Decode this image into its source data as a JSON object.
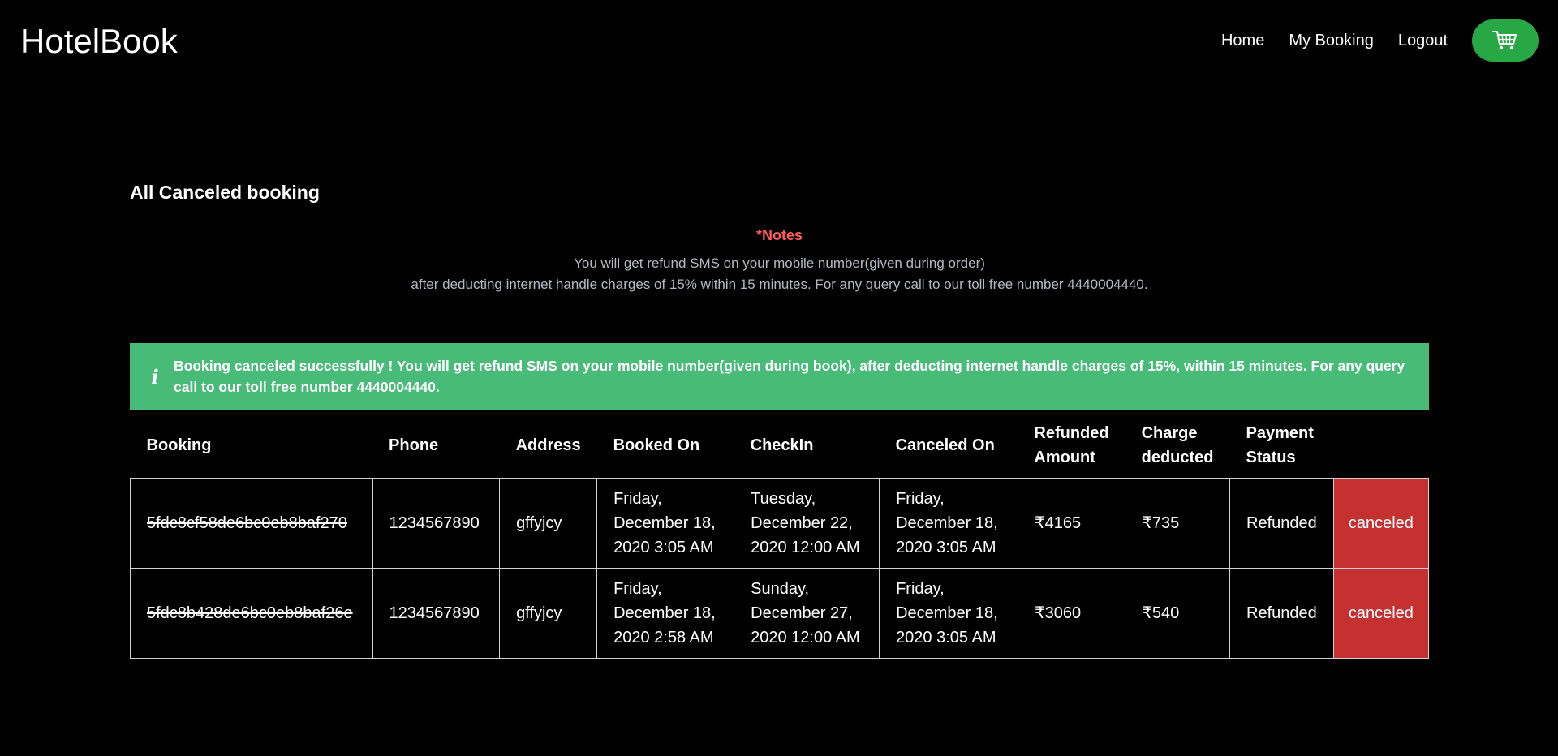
{
  "navbar": {
    "brand": "HotelBook",
    "links": [
      "Home",
      "My Booking",
      "Logout"
    ],
    "cart_icon": "cart-icon",
    "cart_color": "#28a745"
  },
  "page": {
    "title": "All Canceled booking"
  },
  "notes": {
    "heading": "*Notes",
    "line1": "You will get refund SMS on your mobile number(given during order)",
    "line2": "after deducting internet handle charges of 15% within 15 minutes. For any query call to our toll free number 4440004440."
  },
  "alert": {
    "icon": "info-icon",
    "message": "Booking canceled successfully ! You will get refund SMS on your mobile number(given during book), after deducting internet handle charges of 15%, within 15 minutes. For any query call to our toll free number 4440004440.",
    "color": "#48bb78"
  },
  "table": {
    "headers": [
      "Booking",
      "Phone",
      "Address",
      "Booked On",
      "CheckIn",
      "Canceled On",
      "Refunded Amount",
      "Charge deducted",
      "Payment Status",
      ""
    ],
    "rows": [
      {
        "booking": "5fdc8cf58de6bc0eb8baf270",
        "phone": "1234567890",
        "address": "gffyjcy",
        "booked_on": "Friday, December 18, 2020 3:05 AM",
        "checkin": "Tuesday, December 22, 2020 12:00 AM",
        "canceled_on": "Friday, December 18, 2020 3:05 AM",
        "refunded": "₹4165",
        "charge": "₹735",
        "payment_status": "Refunded",
        "status": "canceled"
      },
      {
        "booking": "5fdc8b428de6bc0eb8baf26e",
        "phone": "1234567890",
        "address": "gffyjcy",
        "booked_on": "Friday, December 18, 2020 2:58 AM",
        "checkin": "Sunday, December 27, 2020 12:00 AM",
        "canceled_on": "Friday, December 18, 2020 3:05 AM",
        "refunded": "₹3060",
        "charge": "₹540",
        "payment_status": "Refunded",
        "status": "canceled"
      }
    ],
    "status_color": "#c53030"
  }
}
